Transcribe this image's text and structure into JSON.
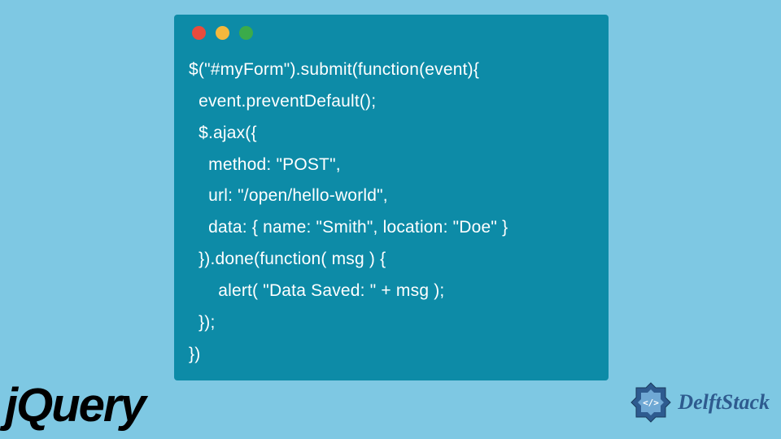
{
  "code": {
    "lines": [
      "$(\"#myForm\").submit(function(event){",
      "  event.preventDefault();",
      "  $.ajax({",
      "    method: \"POST\",",
      "    url: \"/open/hello-world\",",
      "    data: { name: \"Smith\", location: \"Doe\" }",
      "  }).done(function( msg ) {",
      "      alert( \"Data Saved: \" + msg );",
      "  });",
      "})"
    ]
  },
  "logos": {
    "jquery": "jQuery",
    "delftstack": "DelftStack"
  },
  "colors": {
    "background": "#7ec8e3",
    "window": "#0d8ba7",
    "text": "#ffffff",
    "red": "#e94b3c",
    "yellow": "#f5b83d",
    "green": "#3bab4a",
    "delft_blue": "#2e5b8f"
  }
}
